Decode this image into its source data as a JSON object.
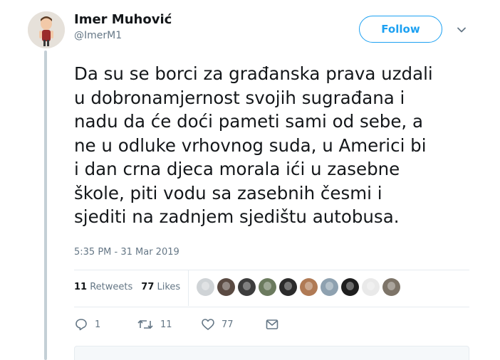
{
  "user": {
    "name": "Imer Muhović",
    "handle": "@ImerM1"
  },
  "follow_label": "Follow",
  "tweet": {
    "text": "Da su se borci za građanska prava uzdali\nu dobronamjernost svojih sugrađana i\nnadu da će doći pameti sami od sebe, a\nne u odluke vrhovnog suda, u Americi bi\ni dan crna djeca morala ići u zasebne\nškole, piti vodu sa zasebnih česmi i\nsjediti na zadnjem sjedištu autobusa.",
    "timestamp": "5:35 PM - 31 Mar 2019"
  },
  "stats": {
    "retweets_count": "11",
    "retweets_label": "Retweets",
    "likes_count": "77",
    "likes_label": "Likes"
  },
  "liker_avatars": [
    {
      "name": "liker-avatar-1",
      "color": "#cfd3d6"
    },
    {
      "name": "liker-avatar-2",
      "color": "#5a4a42"
    },
    {
      "name": "liker-avatar-3",
      "color": "#3d3d3d"
    },
    {
      "name": "liker-avatar-4",
      "color": "#6b7a5e"
    },
    {
      "name": "liker-avatar-5",
      "color": "#2b2b2b"
    },
    {
      "name": "liker-avatar-6",
      "color": "#b07a55"
    },
    {
      "name": "liker-avatar-7",
      "color": "#8ea1b0"
    },
    {
      "name": "liker-avatar-8",
      "color": "#1e1e1e"
    },
    {
      "name": "liker-avatar-9",
      "color": "#e9e9e9"
    },
    {
      "name": "liker-avatar-10",
      "color": "#7d7468"
    }
  ],
  "actions": {
    "reply_count": "1",
    "retweet_count": "11",
    "like_count": "77"
  },
  "colors": {
    "accent": "#1da1f2",
    "text": "#14171a",
    "muted": "#657786",
    "thread_line": "#c4cfd6"
  }
}
